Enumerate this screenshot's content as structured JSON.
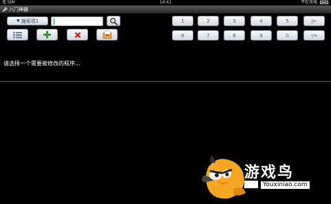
{
  "status_bar": {
    "carrier": "无 SIM",
    "time": "14:41",
    "battery_status": "不在充电"
  },
  "app": {
    "title": "八门神器"
  },
  "search": {
    "scope_label": "搜索项1",
    "input_value": ""
  },
  "keypad": {
    "row1": [
      "1",
      "2",
      "3",
      "4",
      "5",
      "|←"
    ],
    "row2": [
      "6",
      "7",
      "8",
      "9",
      "0",
      "-/+"
    ]
  },
  "main": {
    "prompt": "请选择一个需要被修改的程序..."
  },
  "watermark": {
    "brand": "游戏鸟",
    "url": "Youxiniao.com"
  },
  "colors": {
    "background": "#000000",
    "button_gradient_top": "#f7f9fc",
    "button_gradient_bottom": "#d2d8e0",
    "add_green": "#2aa52a",
    "delete_red": "#d42020"
  }
}
